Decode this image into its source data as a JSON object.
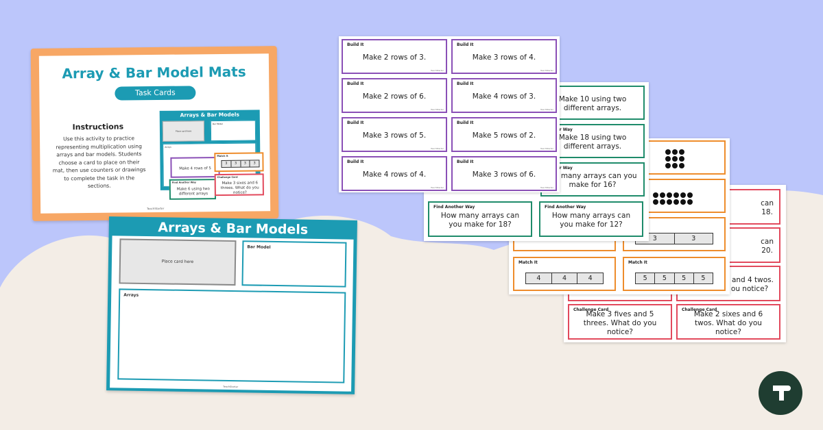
{
  "colors": {
    "teal": "#1c9bb3",
    "purple": "#8a4fb6",
    "green": "#1e8b6a",
    "orange": "#ee8c2b",
    "red": "#e2495c",
    "background": "#bcc6fb",
    "sand": "#f3ede6",
    "logo": "#1f3d31"
  },
  "cover": {
    "title": "Array & Bar Model Mats",
    "subtitle": "Task Cards",
    "instructions_heading": "Instructions",
    "instructions": "Use this activity to practice representing multiplication using arrays and bar models. Students choose a card to place on their mat, then use counters or drawings to complete the task in the sections.",
    "mini_mat_title": "Arrays & Bar Models",
    "mini_place": "Place card here",
    "mini_bar": "Bar Model",
    "mini_arrays": "Arrays",
    "mini_card_1": "Make 4 rows of 5",
    "mini_card_2_cat": "Match It",
    "mini_card_2_cells": [
      "3",
      "3",
      "3",
      "3"
    ],
    "mini_card_3_cat": "Find Another Way",
    "mini_card_3": "Make 6 using two different arrays",
    "mini_card_4_cat": "Challenge Card",
    "mini_card_4": "Make 3 sixes and 6 threes. What do you notice?",
    "brand": "TeachStarter"
  },
  "mat": {
    "title": "Arrays & Bar Models",
    "place_label": "Place card here",
    "bar_label": "Bar Model",
    "arrays_label": "Arrays",
    "brand": "TeachStarter"
  },
  "build_it": {
    "category": "Build It",
    "cards": [
      "Make 2 rows of 3.",
      "Make 3 rows of 4.",
      "Make 2 rows of 6.",
      "Make 4 rows of 3.",
      "Make 3 rows of 5.",
      "Make 5 rows of 2.",
      "Make 4 rows of 4.",
      "Make 3 rows of 6."
    ]
  },
  "find_another_way": {
    "category": "Find Another Way",
    "category_partial": "nother Way",
    "top_1": "Make 10 using two different arrays.",
    "top_2": "Make 18 using two different arrays.",
    "top_3": "ow many arrays can you make for 16?",
    "card_1": "How many arrays can you make for 18?",
    "card_2": "How many arrays can you make for 12?"
  },
  "match_it": {
    "category": "Match It",
    "card_1_cells": [
      "4",
      "4",
      "4"
    ],
    "card_2_cells": [
      "5",
      "5",
      "5",
      "5"
    ],
    "partial_cells": [
      "3",
      "3"
    ]
  },
  "challenge": {
    "category": "Challenge Card",
    "peek_1": "can",
    "peek_1b": "18.",
    "peek_2": "can",
    "peek_2b": "20.",
    "peek_3": "s and 4 twos.",
    "peek_3b": "ou notice?",
    "card_1": "Make 3 fives and 5 threes. What do you notice?",
    "card_2": "Make 2 sixes and 6 twos. What do you notice?"
  },
  "brand": "TeachStarter",
  "logo_icon": "teach-starter-logo"
}
